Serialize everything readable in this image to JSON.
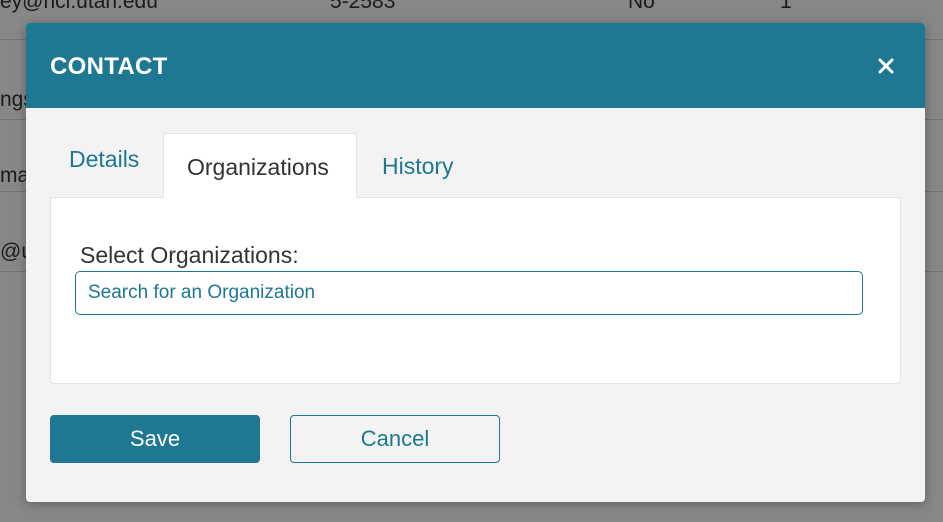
{
  "background_table": {
    "rows": [
      {
        "col1": "ey@hci.utah.edu",
        "col2": "5-2583",
        "col3": "No",
        "col4": "1"
      },
      {
        "col1": "ngs",
        "col2": "",
        "col3": "",
        "col4": ""
      },
      {
        "col1": "mai",
        "col2": "",
        "col3": "",
        "col4": ""
      },
      {
        "col1": "@ur",
        "col2": "",
        "col3": "",
        "col4": ""
      }
    ]
  },
  "modal": {
    "title": "CONTACT",
    "close_icon": "close-icon",
    "tabs": [
      {
        "label": "Details",
        "active": false
      },
      {
        "label": "Organizations",
        "active": true
      },
      {
        "label": "History",
        "active": false
      }
    ],
    "organizations": {
      "label": "Select Organizations:",
      "search_placeholder": "Search for an Organization"
    },
    "buttons": {
      "save_label": "Save",
      "cancel_label": "Cancel"
    }
  },
  "colors": {
    "accent": "#1e7891",
    "modal_background": "#f3f3f3",
    "panel_background": "#ffffff"
  }
}
